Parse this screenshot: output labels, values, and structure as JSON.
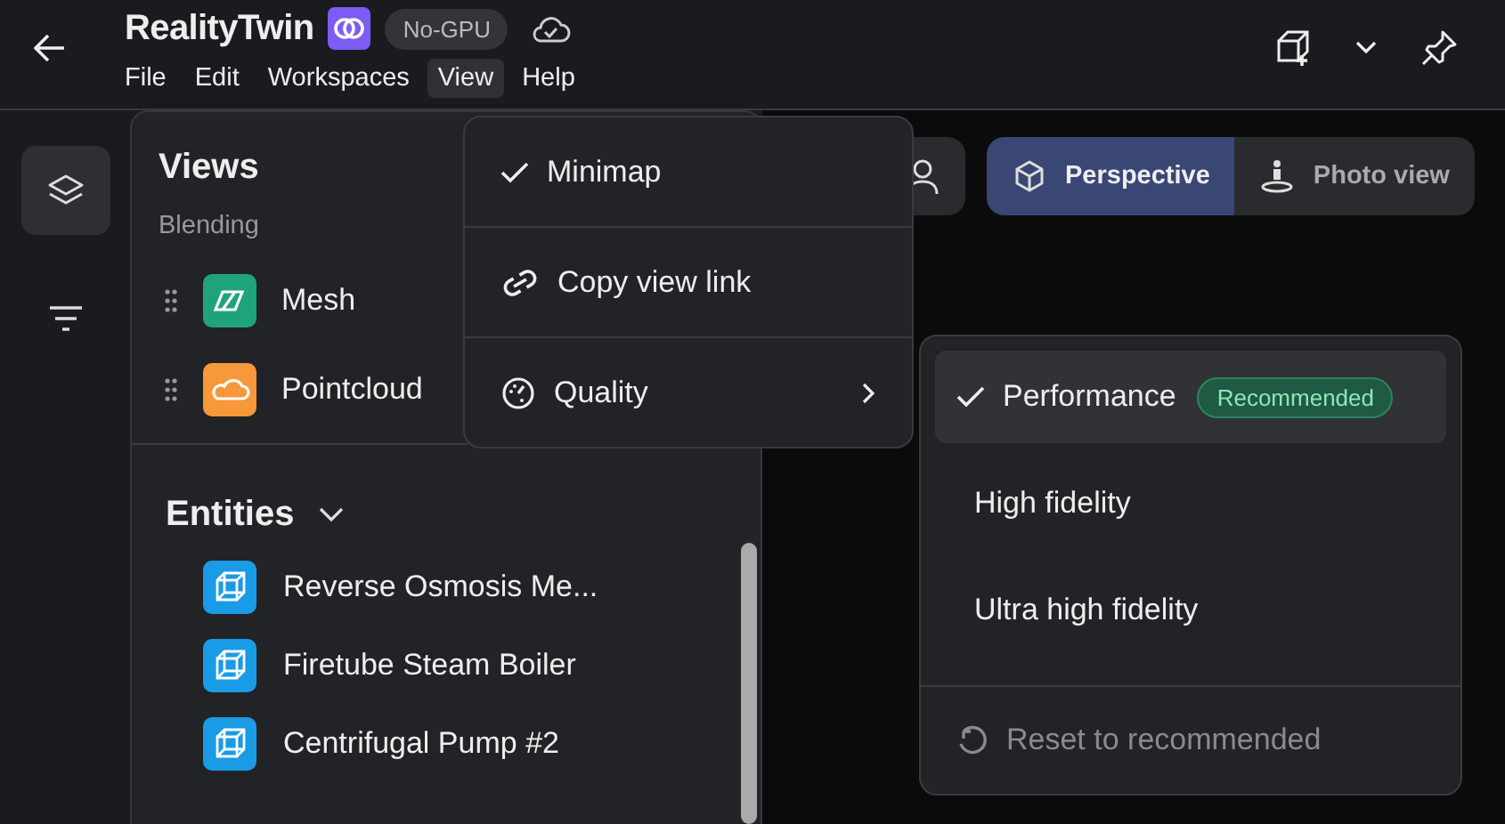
{
  "app": {
    "title": "RealityTwin",
    "badge": "No-GPU"
  },
  "menu": [
    {
      "label": "File",
      "selected": false
    },
    {
      "label": "Edit",
      "selected": false
    },
    {
      "label": "Workspaces",
      "selected": false
    },
    {
      "label": "View",
      "selected": true
    },
    {
      "label": "Help",
      "selected": false
    }
  ],
  "sidebar": [
    {
      "kind": "layers",
      "selected": true
    },
    {
      "kind": "filter",
      "selected": false
    }
  ],
  "views_panel": {
    "title": "Views",
    "section": "Blending",
    "layers": [
      {
        "name": "Mesh",
        "kind": "mesh",
        "color": "#1fa37a"
      },
      {
        "name": "Pointcloud",
        "kind": "cloud",
        "color": "#f7983a"
      }
    ],
    "entities_heading": "Entities",
    "expanded": true,
    "entities": [
      "Reverse Osmosis Me...",
      "Firetube Steam Boiler",
      "Centrifugal Pump #2"
    ]
  },
  "view_modes": [
    {
      "label": "Perspective",
      "kind": "cube",
      "selected": true
    },
    {
      "label": "Photo view",
      "kind": "person",
      "selected": false
    }
  ],
  "view_menu": [
    {
      "kind": "check",
      "label": "Minimap",
      "checked": true
    },
    {
      "kind": "link",
      "label": "Copy view link"
    },
    {
      "kind": "submenu",
      "label": "Quality"
    }
  ],
  "quality_menu": {
    "options": [
      {
        "label": "Performance",
        "selected": true,
        "badge": "Recommended"
      },
      {
        "label": "High fidelity",
        "selected": false
      },
      {
        "label": "Ultra high fidelity",
        "selected": false
      }
    ],
    "reset": {
      "label": "Reset to recommended",
      "disabled": true
    }
  }
}
